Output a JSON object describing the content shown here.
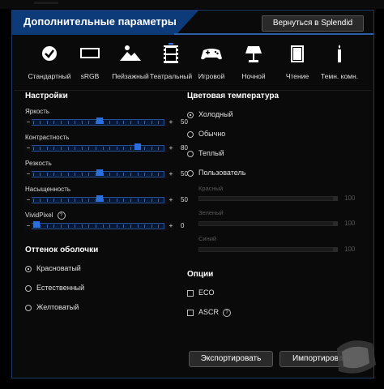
{
  "header": {
    "title": "Дополнительные параметры",
    "back_button": "Вернуться в Splendid"
  },
  "modes": [
    {
      "label": "Стандартный",
      "icon": "check-circle-icon"
    },
    {
      "label": "sRGB",
      "icon": "monitor-icon"
    },
    {
      "label": "Пейзажный",
      "icon": "landscape-icon"
    },
    {
      "label": "Театральный",
      "icon": "film-icon",
      "selected": true
    },
    {
      "label": "Игровой",
      "icon": "gamepad-icon"
    },
    {
      "label": "Ночной",
      "icon": "lamp-icon"
    },
    {
      "label": "Чтение",
      "icon": "book-icon"
    },
    {
      "label": "Темн. комн.",
      "icon": "candle-icon"
    }
  ],
  "settings": {
    "title": "Настройки",
    "sliders": [
      {
        "label": "Яркость",
        "value": "50",
        "level": 0.5
      },
      {
        "label": "Контрастность",
        "value": "80",
        "level": 0.8
      },
      {
        "label": "Резкость",
        "value": "50",
        "level": 0.5
      },
      {
        "label": "Насыщенность",
        "value": "50",
        "level": 0.5
      },
      {
        "label": "VividPixel",
        "value": "0",
        "level": 0.0
      }
    ],
    "minus": "−",
    "plus": "+"
  },
  "skin_tone": {
    "title": "Оттенок оболочки",
    "options": [
      "Красноватый",
      "Естественный",
      "Желтоватый"
    ],
    "selected": 0
  },
  "color_temp": {
    "title": "Цветовая температура",
    "options": [
      "Холодный",
      "Обычно",
      "Теплый",
      "Пользователь"
    ],
    "selected": 0,
    "channels": [
      {
        "label": "Красный",
        "value": "100"
      },
      {
        "label": "Зеленый",
        "value": "100"
      },
      {
        "label": "Синий",
        "value": "100"
      }
    ]
  },
  "options": {
    "title": "Опции",
    "items": [
      "ECO",
      "ASCR"
    ]
  },
  "footer": {
    "export": "Экспортировать",
    "import": "Импортировать"
  },
  "help_glyph": "?",
  "accent_color": "#2a6fe0",
  "title_bar_color": "#0d3a78"
}
